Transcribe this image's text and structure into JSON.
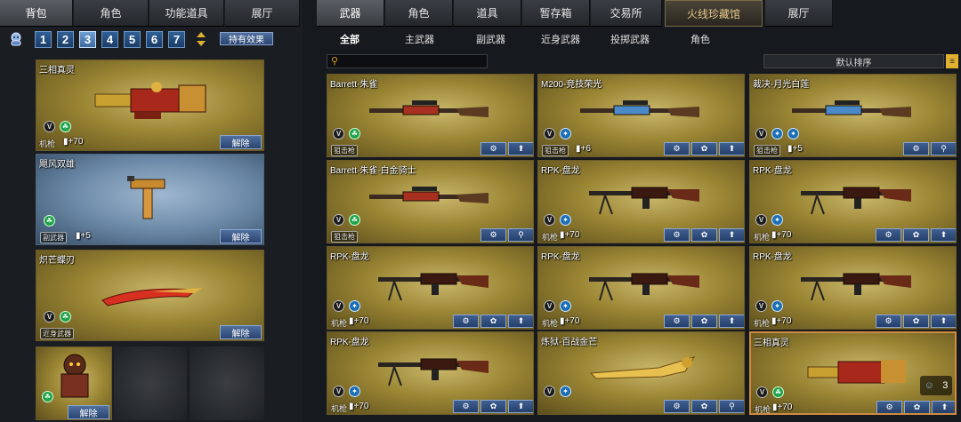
{
  "left_tabs": [
    "背包",
    "角色",
    "功能道具",
    "展厅"
  ],
  "right_tabs": [
    "武器",
    "角色",
    "道具",
    "暂存箱",
    "交易所",
    "火线珍藏馆",
    "展厅"
  ],
  "sub_tabs": [
    "全部",
    "主武器",
    "副武器",
    "近身武器",
    "投掷武器",
    "角色"
  ],
  "pages": [
    "1",
    "2",
    "3",
    "4",
    "5",
    "6",
    "7"
  ],
  "hold_effect": "持有效果",
  "sort_label": "默认排序",
  "search_placeholder": "",
  "colors": {
    "accent": "#d08a40",
    "gold_card": "#9b8634",
    "blue_card": "#6c8aa8",
    "button": "#2a4470"
  },
  "left_items": [
    {
      "name": "三相真灵",
      "type": "机枪",
      "stat": "+70",
      "button": "解除"
    },
    {
      "name": "飓风双雄",
      "type": "副武器",
      "stat": "+5",
      "button": "解除"
    },
    {
      "name": "炽芒蝶刃",
      "type": "近身武器",
      "stat": "",
      "button": "解除"
    }
  ],
  "char_slot_button": "解除",
  "grid_items": [
    {
      "name": "Barrett-朱雀",
      "type": "狙击枪",
      "stat": ""
    },
    {
      "name": "M200-竞技荣光",
      "type": "狙击枪",
      "stat": "+6"
    },
    {
      "name": "裁决-月光白莲",
      "type": "狙击枪",
      "stat": "+5"
    },
    {
      "name": "Barrett-朱雀-白金骑士",
      "type": "狙击枪",
      "stat": ""
    },
    {
      "name": "RPK-盘龙",
      "type": "机枪",
      "stat": "+70"
    },
    {
      "name": "RPK-盘龙",
      "type": "机枪",
      "stat": "+70"
    },
    {
      "name": "RPK-盘龙",
      "type": "机枪",
      "stat": "+70"
    },
    {
      "name": "RPK-盘龙",
      "type": "机枪",
      "stat": "+70"
    },
    {
      "name": "RPK-盘龙",
      "type": "机枪",
      "stat": "+70"
    },
    {
      "name": "RPK-盘龙",
      "type": "机枪",
      "stat": "+70"
    },
    {
      "name": "炼狱-百战金芒",
      "type": "",
      "stat": ""
    },
    {
      "name": "三相真灵",
      "type": "机枪",
      "stat": "+70"
    }
  ],
  "stack_count": "3"
}
